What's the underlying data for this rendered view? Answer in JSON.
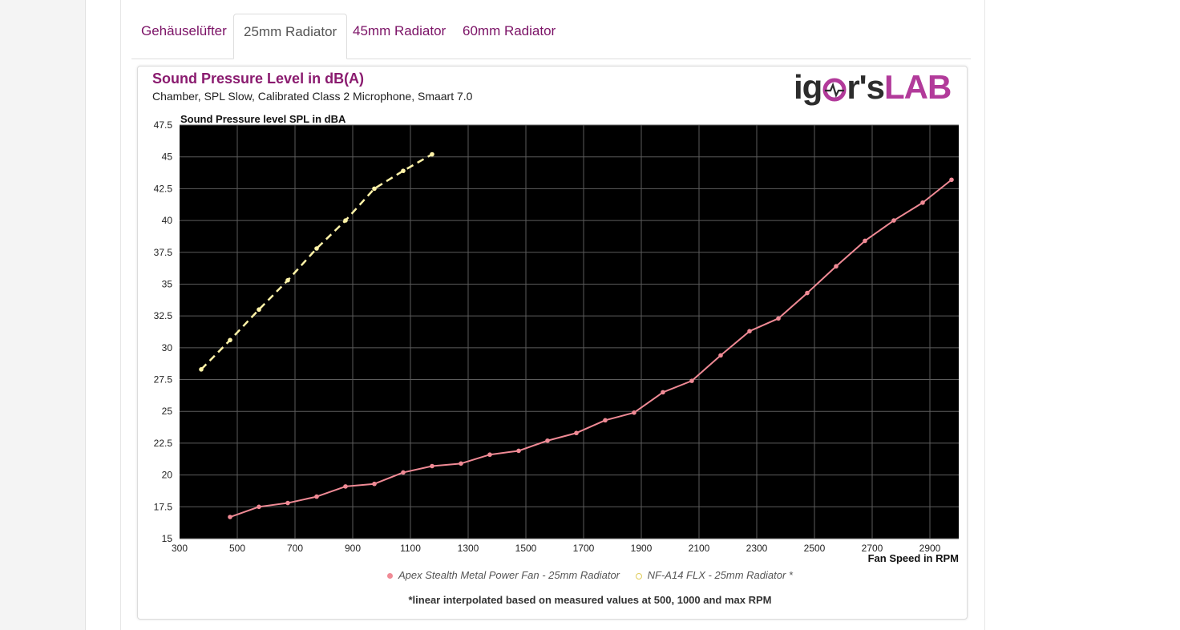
{
  "tabs": [
    {
      "label": "Gehäuselüfter",
      "active": false
    },
    {
      "label": "25mm Radiator",
      "active": true
    },
    {
      "label": "45mm Radiator",
      "active": false
    },
    {
      "label": "60mm Radiator",
      "active": false
    }
  ],
  "logo": {
    "part1": "ig",
    "part2": "r's",
    "part3": "LAB",
    "accent_color": "#b23a9a"
  },
  "chart_data": {
    "type": "line",
    "title": "Sound Pressure Level in dB(A)",
    "subtitle": "Chamber, SPL Slow, Calibrated Class 2 Microphone, Smaart 7.0",
    "ylabel": "Sound Pressure level SPL in dBA",
    "xlabel": "Fan Speed in RPM",
    "xlim": [
      300,
      3000
    ],
    "ylim": [
      15,
      47.5
    ],
    "xticks": [
      300,
      500,
      700,
      900,
      1100,
      1300,
      1500,
      1700,
      1900,
      2100,
      2300,
      2500,
      2700,
      2900
    ],
    "yticks": [
      15,
      17.5,
      20,
      22.5,
      25,
      27.5,
      30,
      32.5,
      35,
      37.5,
      40,
      42.5,
      45,
      47.5
    ],
    "grid": true,
    "background": "#000000",
    "series": [
      {
        "name": "Apex Stealth Metal Power Fan - 25mm Radiator",
        "color": "#f08a95",
        "style": "solid",
        "x": [
          475,
          575,
          675,
          775,
          875,
          975,
          1075,
          1175,
          1275,
          1375,
          1475,
          1575,
          1675,
          1775,
          1875,
          1975,
          2075,
          2175,
          2275,
          2375,
          2475,
          2575,
          2675,
          2775,
          2875,
          2975
        ],
        "y": [
          16.7,
          17.5,
          17.8,
          18.3,
          19.1,
          19.3,
          20.2,
          20.7,
          20.9,
          21.6,
          21.9,
          22.7,
          23.3,
          24.3,
          24.9,
          26.5,
          27.4,
          29.4,
          31.3,
          32.3,
          34.3,
          36.4,
          38.4,
          40.0,
          41.4,
          43.2
        ]
      },
      {
        "name": "NF-A14 FLX - 25mm Radiator *",
        "color": "#fff3a8",
        "style": "dashed",
        "x": [
          375,
          475,
          575,
          675,
          775,
          875,
          975,
          1075,
          1175
        ],
        "y": [
          28.3,
          30.6,
          33.0,
          35.3,
          37.8,
          40.0,
          42.5,
          43.9,
          45.2
        ]
      }
    ]
  },
  "footnote": "*linear interpolated based on measured values at 500, 1000 and max RPM"
}
